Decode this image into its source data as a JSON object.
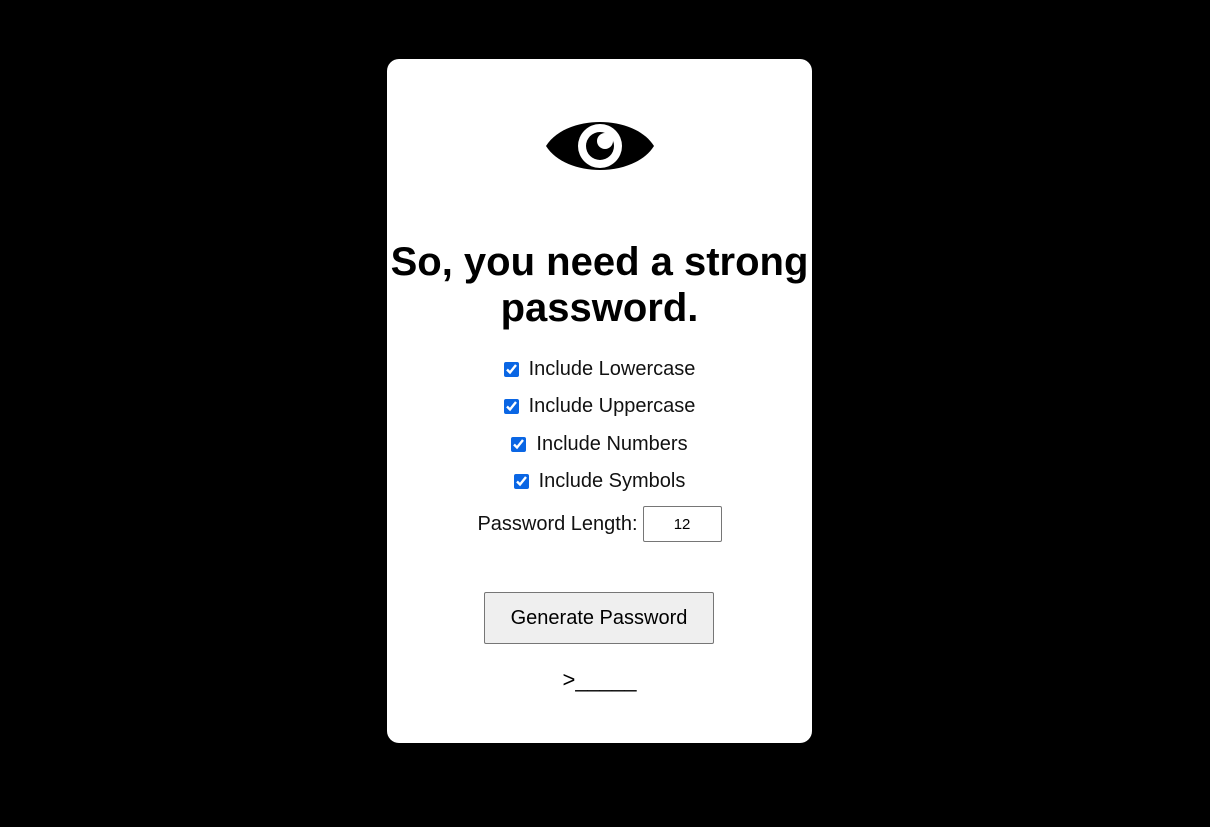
{
  "card": {
    "icon": "eye-icon",
    "title": "So, you need a strong password."
  },
  "options": [
    {
      "label": "Include Lowercase",
      "checked": true
    },
    {
      "label": "Include Uppercase",
      "checked": true
    },
    {
      "label": "Include Numbers",
      "checked": true
    },
    {
      "label": "Include Symbols",
      "checked": true
    }
  ],
  "length": {
    "label": "Password Length:",
    "value": "12"
  },
  "generate_button": {
    "label": "Generate Password"
  },
  "output": {
    "text": ">_____"
  },
  "colors": {
    "background": "#000000",
    "card": "#ffffff",
    "checkbox_accent": "#0a66e4"
  }
}
